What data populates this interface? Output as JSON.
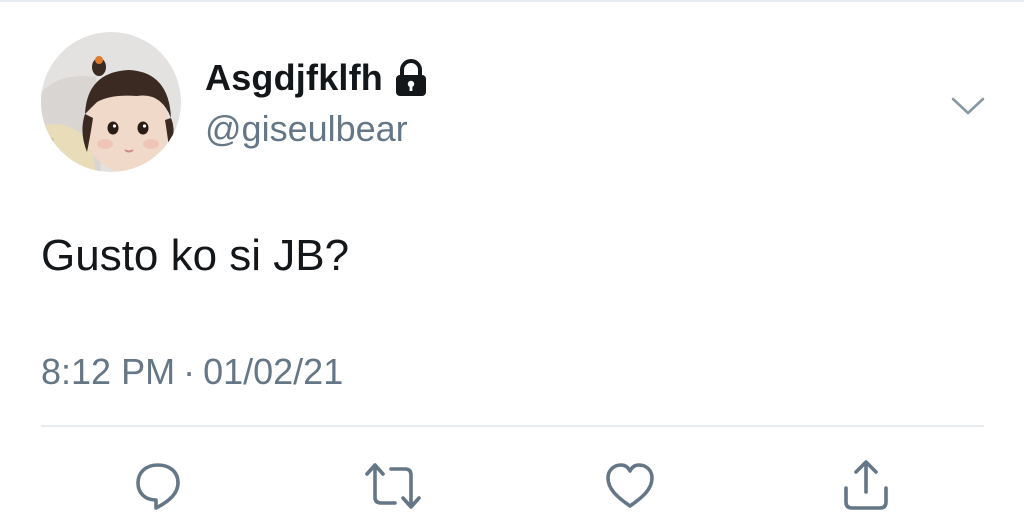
{
  "author": {
    "display_name": "Asgdjfklfh",
    "handle": "@giseulbear",
    "protected_icon": "lock-icon",
    "avatar": "avatar-photo"
  },
  "tweet": {
    "text": "Gusto ko si JB?",
    "time": "8:12 PM",
    "separator": "·",
    "date": "01/02/21"
  },
  "actions": [
    {
      "name": "reply",
      "icon": "comment-bubble-icon"
    },
    {
      "name": "retweet",
      "icon": "retweet-arrows-icon"
    },
    {
      "name": "like",
      "icon": "heart-icon"
    },
    {
      "name": "share",
      "icon": "share-upload-icon"
    }
  ],
  "menu_icon": "chevron-down-icon",
  "colors": {
    "primary_text": "#14171a",
    "secondary_text": "#657786",
    "divider": "#e6ecf0",
    "background": "#ffffff"
  }
}
